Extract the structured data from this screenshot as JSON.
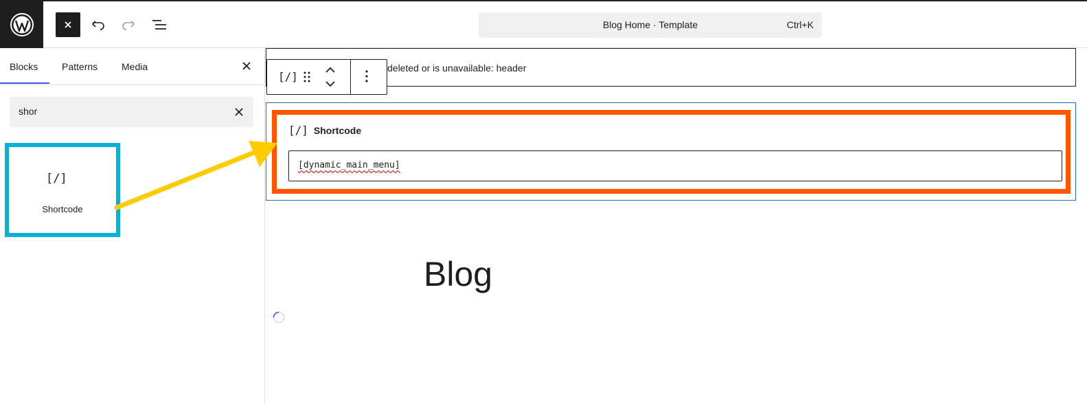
{
  "topbar": {
    "logo_icon": "wordpress-logo-icon",
    "close_icon": "close-icon",
    "undo_icon": "undo-icon",
    "redo_icon": "redo-icon",
    "list_view_icon": "list-view-icon",
    "command_title": "Blog Home · Template",
    "command_shortcut": "Ctrl+K"
  },
  "sidebar": {
    "tabs": [
      {
        "label": "Blocks",
        "active": true
      },
      {
        "label": "Patterns",
        "active": false
      },
      {
        "label": "Media",
        "active": false
      }
    ],
    "search_value": "shor",
    "results": [
      {
        "label": "Shortcode",
        "icon": "[/]"
      }
    ],
    "highlight_color": "#0ab1d6"
  },
  "canvas": {
    "missing_block_text": "deleted or is unavailable: header",
    "toolbar_block_icon": "[/]",
    "shortcode_block": {
      "label": "Shortcode",
      "icon": "[/]",
      "value": "[dynamic_main_menu]"
    },
    "highlight_color": "#ff5500",
    "blog_title": "Blog"
  },
  "annotation": {
    "arrow_color": "#ffcc00"
  }
}
